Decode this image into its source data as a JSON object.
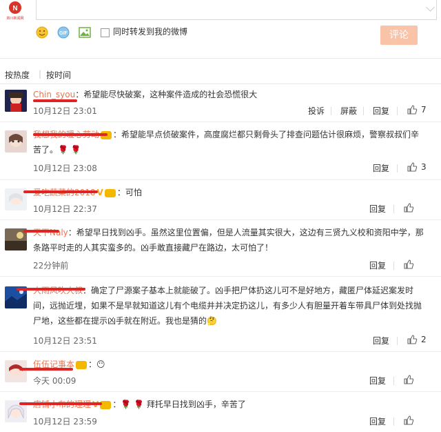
{
  "composer": {
    "logo_text": "四川新闻网",
    "forward_label": "同时转发到我的微博",
    "submit_label": "评论"
  },
  "sort": {
    "hot": "按热度",
    "time": "按时间"
  },
  "comments": [
    {
      "name": "Chin_syou",
      "text": "：希望能尽快破案，这种案件造成的社会恐慌很大",
      "time": "10月12日 23:01",
      "report": "投诉",
      "block": "屏蔽",
      "reply": "回复",
      "likes": "7"
    },
    {
      "name": "我想我的暖心劳动",
      "text": "：希望能早点侦破案件，高度腐烂都只剩骨头了排查问题估计很麻烦，警察叔叔们辛苦了。",
      "emoji": "🌹 🌹",
      "time": "10月12日 23:08",
      "reply": "回复",
      "likes": "3"
    },
    {
      "name": "爱吃蔬菜的2018",
      "text": "：可怕",
      "time": "10月12日 22:37",
      "reply": "回复",
      "likes": ""
    },
    {
      "name": "天下Naly",
      "text": "：希望早日找到凶手。虽然这里位置偏，但是人流量其实很大，这边有三贤九义校和资阳中学，那条路平时走的人其实蛮多的。凶手敢直接藏尸在路边，太可怕了！",
      "time": "22分钟前",
      "reply": "回复",
      "likes": ""
    },
    {
      "name": "大雨风吹大叔",
      "text": "：确定了尸源案子基本上就能破了。凶手把尸体扔这儿可不是好地方，藏匿尸体延迟案发时间，远抛近埋，如果不是早就知道这儿有个电缆井并决定扔这儿，有多少人有胆量开着车带具尸体到处找抛尸地，这些都在提示凶手就在附近。我也是猜的",
      "emoji": "🤔",
      "time": "10月12日 23:51",
      "reply": "回复",
      "likes": "2"
    },
    {
      "name": "伍伍记事本",
      "text": "：",
      "emoji": "😶",
      "time": "今天 00:09",
      "reply": "回复",
      "likes": ""
    },
    {
      "name": "店铺小布的理理",
      "text": "：",
      "emoji": "🌹 🌹",
      "text2": "拜托早日找到凶手，辛苦了",
      "time": "10月12日 23:59",
      "reply": "回复",
      "likes": ""
    }
  ],
  "colors": {
    "username": "#eb7350",
    "submit_bg": "#f9c3a8",
    "redact": "#e02424"
  }
}
